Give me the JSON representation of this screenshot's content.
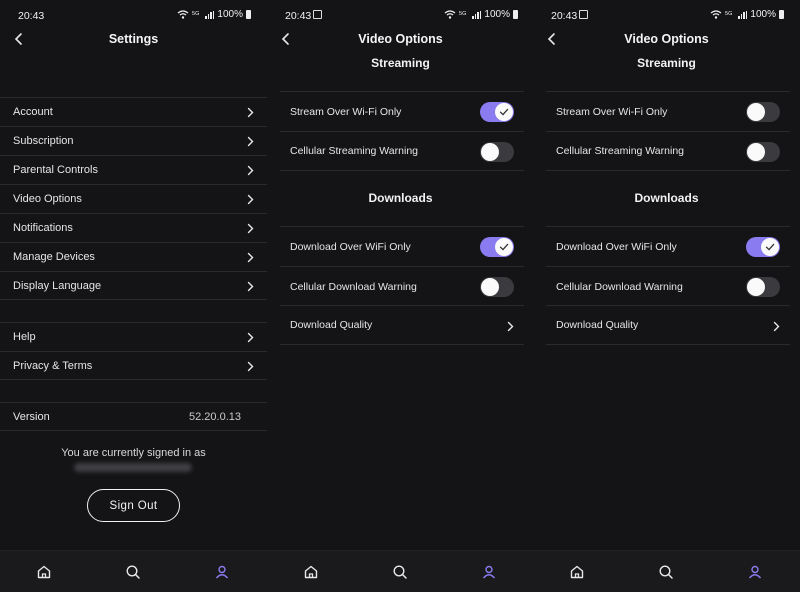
{
  "status": {
    "time": "20:43",
    "network": "5G",
    "battery": "100%"
  },
  "colors": {
    "accent": "#8a7cf0",
    "background": "#141416",
    "divider": "#2a2a2e"
  },
  "settings_screen": {
    "title": "Settings",
    "group1": [
      {
        "label": "Account"
      },
      {
        "label": "Subscription"
      },
      {
        "label": "Parental Controls"
      },
      {
        "label": "Video Options"
      },
      {
        "label": "Notifications"
      },
      {
        "label": "Manage Devices"
      },
      {
        "label": "Display Language"
      }
    ],
    "group2": [
      {
        "label": "Help"
      },
      {
        "label": "Privacy & Terms"
      }
    ],
    "version_label": "Version",
    "version_value": "52.20.0.13",
    "signed_in_text": "You are currently signed in as",
    "sign_out_label": "Sign Out"
  },
  "video_options_screen_a": {
    "title": "Video Options",
    "streaming_title": "Streaming",
    "stream_wifi_label": "Stream Over Wi-Fi Only",
    "stream_wifi_on": true,
    "cellular_streaming_label": "Cellular Streaming Warning",
    "cellular_streaming_on": false,
    "downloads_title": "Downloads",
    "download_wifi_label": "Download Over WiFi Only",
    "download_wifi_on": true,
    "cellular_download_label": "Cellular Download Warning",
    "cellular_download_on": false,
    "download_quality_label": "Download Quality"
  },
  "video_options_screen_b": {
    "title": "Video Options",
    "streaming_title": "Streaming",
    "stream_wifi_label": "Stream Over Wi-Fi Only",
    "stream_wifi_on": false,
    "cellular_streaming_label": "Cellular Streaming Warning",
    "cellular_streaming_on": false,
    "downloads_title": "Downloads",
    "download_wifi_label": "Download Over WiFi Only",
    "download_wifi_on": true,
    "cellular_download_label": "Cellular Download Warning",
    "cellular_download_on": false,
    "download_quality_label": "Download Quality"
  },
  "icons": {
    "back": "chevron-left-icon",
    "chevron": "chevron-right-icon",
    "home": "home-icon",
    "search": "search-icon",
    "account": "user-icon",
    "check": "check-icon"
  }
}
